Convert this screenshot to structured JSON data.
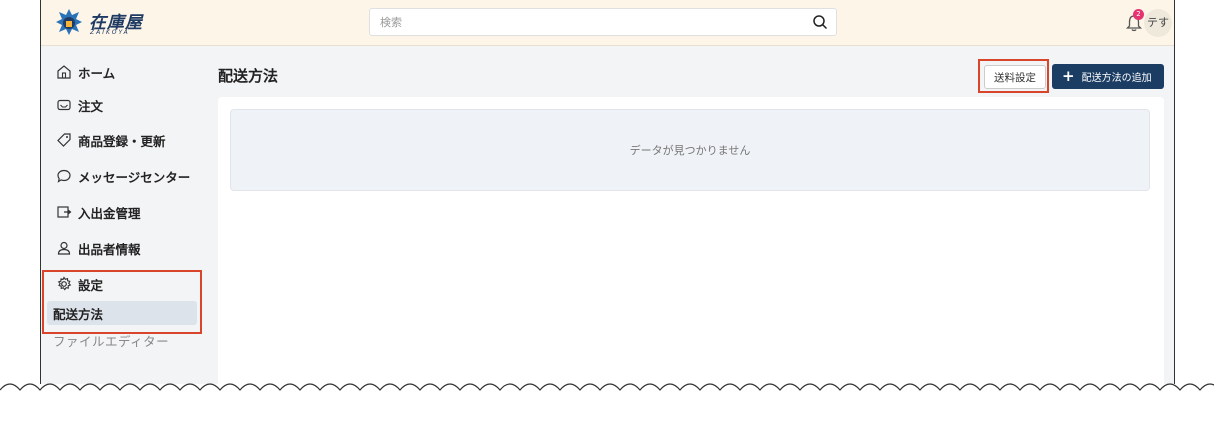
{
  "header": {
    "logo_text": "在庫屋",
    "logo_sub": "ZAIKOYA",
    "search_placeholder": "検索",
    "notification_count": "2",
    "user_initials": "テす"
  },
  "sidebar": {
    "items": [
      {
        "label": "ホーム",
        "icon": "home-icon"
      },
      {
        "label": "注文",
        "icon": "inbox-icon"
      },
      {
        "label": "商品登録・更新",
        "icon": "tag-icon"
      },
      {
        "label": "メッセージセンター",
        "icon": "chat-icon"
      },
      {
        "label": "入出金管理",
        "icon": "transfer-icon"
      },
      {
        "label": "出品者情報",
        "icon": "user-icon"
      },
      {
        "label": "設定",
        "icon": "gear-icon"
      }
    ],
    "settings_sub": [
      {
        "label": "配送方法",
        "active": true
      },
      {
        "label": "ファイルエディター",
        "active": false
      }
    ]
  },
  "main": {
    "title": "配送方法",
    "shipping_settings_button": "送料設定",
    "add_button": "配送方法の追加",
    "empty_message": "データが見つかりません"
  },
  "colors": {
    "header_bg": "#fdf5e8",
    "primary": "#1b3d63",
    "highlight": "#d9452b",
    "badge": "#e6336f"
  }
}
